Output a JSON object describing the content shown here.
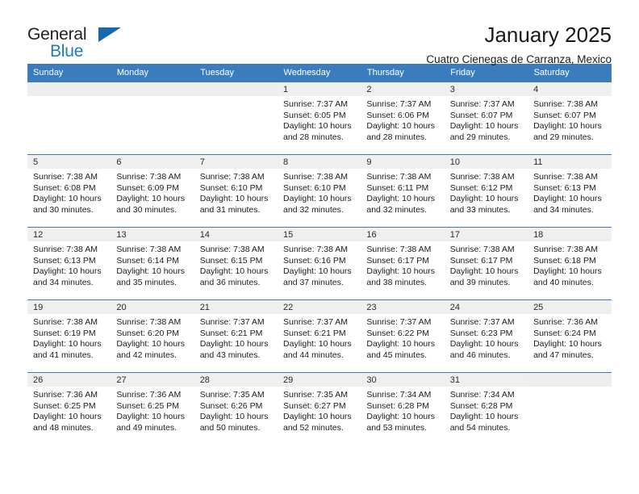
{
  "logo": {
    "word_top": "General",
    "word_bottom": "Blue",
    "triangle_color": "#1668ad",
    "text_color": "#231f20",
    "blue_color": "#1f7ac0"
  },
  "header": {
    "title": "January 2025",
    "subtitle": "Cuatro Cienegas de Carranza, Mexico"
  },
  "theme": {
    "header_bg": "#3b7cbf",
    "header_text": "#ffffff",
    "daynum_bg": "#efefef",
    "border": "#3b7cbf"
  },
  "weekdays": [
    "Sunday",
    "Monday",
    "Tuesday",
    "Wednesday",
    "Thursday",
    "Friday",
    "Saturday"
  ],
  "weeks": [
    [
      {
        "empty": true
      },
      {
        "empty": true
      },
      {
        "empty": true
      },
      {
        "day": "1",
        "sunrise": "Sunrise: 7:37 AM",
        "sunset": "Sunset: 6:05 PM",
        "daylight1": "Daylight: 10 hours",
        "daylight2": "and 28 minutes."
      },
      {
        "day": "2",
        "sunrise": "Sunrise: 7:37 AM",
        "sunset": "Sunset: 6:06 PM",
        "daylight1": "Daylight: 10 hours",
        "daylight2": "and 28 minutes."
      },
      {
        "day": "3",
        "sunrise": "Sunrise: 7:37 AM",
        "sunset": "Sunset: 6:07 PM",
        "daylight1": "Daylight: 10 hours",
        "daylight2": "and 29 minutes."
      },
      {
        "day": "4",
        "sunrise": "Sunrise: 7:38 AM",
        "sunset": "Sunset: 6:07 PM",
        "daylight1": "Daylight: 10 hours",
        "daylight2": "and 29 minutes."
      }
    ],
    [
      {
        "day": "5",
        "sunrise": "Sunrise: 7:38 AM",
        "sunset": "Sunset: 6:08 PM",
        "daylight1": "Daylight: 10 hours",
        "daylight2": "and 30 minutes."
      },
      {
        "day": "6",
        "sunrise": "Sunrise: 7:38 AM",
        "sunset": "Sunset: 6:09 PM",
        "daylight1": "Daylight: 10 hours",
        "daylight2": "and 30 minutes."
      },
      {
        "day": "7",
        "sunrise": "Sunrise: 7:38 AM",
        "sunset": "Sunset: 6:10 PM",
        "daylight1": "Daylight: 10 hours",
        "daylight2": "and 31 minutes."
      },
      {
        "day": "8",
        "sunrise": "Sunrise: 7:38 AM",
        "sunset": "Sunset: 6:10 PM",
        "daylight1": "Daylight: 10 hours",
        "daylight2": "and 32 minutes."
      },
      {
        "day": "9",
        "sunrise": "Sunrise: 7:38 AM",
        "sunset": "Sunset: 6:11 PM",
        "daylight1": "Daylight: 10 hours",
        "daylight2": "and 32 minutes."
      },
      {
        "day": "10",
        "sunrise": "Sunrise: 7:38 AM",
        "sunset": "Sunset: 6:12 PM",
        "daylight1": "Daylight: 10 hours",
        "daylight2": "and 33 minutes."
      },
      {
        "day": "11",
        "sunrise": "Sunrise: 7:38 AM",
        "sunset": "Sunset: 6:13 PM",
        "daylight1": "Daylight: 10 hours",
        "daylight2": "and 34 minutes."
      }
    ],
    [
      {
        "day": "12",
        "sunrise": "Sunrise: 7:38 AM",
        "sunset": "Sunset: 6:13 PM",
        "daylight1": "Daylight: 10 hours",
        "daylight2": "and 34 minutes."
      },
      {
        "day": "13",
        "sunrise": "Sunrise: 7:38 AM",
        "sunset": "Sunset: 6:14 PM",
        "daylight1": "Daylight: 10 hours",
        "daylight2": "and 35 minutes."
      },
      {
        "day": "14",
        "sunrise": "Sunrise: 7:38 AM",
        "sunset": "Sunset: 6:15 PM",
        "daylight1": "Daylight: 10 hours",
        "daylight2": "and 36 minutes."
      },
      {
        "day": "15",
        "sunrise": "Sunrise: 7:38 AM",
        "sunset": "Sunset: 6:16 PM",
        "daylight1": "Daylight: 10 hours",
        "daylight2": "and 37 minutes."
      },
      {
        "day": "16",
        "sunrise": "Sunrise: 7:38 AM",
        "sunset": "Sunset: 6:17 PM",
        "daylight1": "Daylight: 10 hours",
        "daylight2": "and 38 minutes."
      },
      {
        "day": "17",
        "sunrise": "Sunrise: 7:38 AM",
        "sunset": "Sunset: 6:17 PM",
        "daylight1": "Daylight: 10 hours",
        "daylight2": "and 39 minutes."
      },
      {
        "day": "18",
        "sunrise": "Sunrise: 7:38 AM",
        "sunset": "Sunset: 6:18 PM",
        "daylight1": "Daylight: 10 hours",
        "daylight2": "and 40 minutes."
      }
    ],
    [
      {
        "day": "19",
        "sunrise": "Sunrise: 7:38 AM",
        "sunset": "Sunset: 6:19 PM",
        "daylight1": "Daylight: 10 hours",
        "daylight2": "and 41 minutes."
      },
      {
        "day": "20",
        "sunrise": "Sunrise: 7:38 AM",
        "sunset": "Sunset: 6:20 PM",
        "daylight1": "Daylight: 10 hours",
        "daylight2": "and 42 minutes."
      },
      {
        "day": "21",
        "sunrise": "Sunrise: 7:37 AM",
        "sunset": "Sunset: 6:21 PM",
        "daylight1": "Daylight: 10 hours",
        "daylight2": "and 43 minutes."
      },
      {
        "day": "22",
        "sunrise": "Sunrise: 7:37 AM",
        "sunset": "Sunset: 6:21 PM",
        "daylight1": "Daylight: 10 hours",
        "daylight2": "and 44 minutes."
      },
      {
        "day": "23",
        "sunrise": "Sunrise: 7:37 AM",
        "sunset": "Sunset: 6:22 PM",
        "daylight1": "Daylight: 10 hours",
        "daylight2": "and 45 minutes."
      },
      {
        "day": "24",
        "sunrise": "Sunrise: 7:37 AM",
        "sunset": "Sunset: 6:23 PM",
        "daylight1": "Daylight: 10 hours",
        "daylight2": "and 46 minutes."
      },
      {
        "day": "25",
        "sunrise": "Sunrise: 7:36 AM",
        "sunset": "Sunset: 6:24 PM",
        "daylight1": "Daylight: 10 hours",
        "daylight2": "and 47 minutes."
      }
    ],
    [
      {
        "day": "26",
        "sunrise": "Sunrise: 7:36 AM",
        "sunset": "Sunset: 6:25 PM",
        "daylight1": "Daylight: 10 hours",
        "daylight2": "and 48 minutes."
      },
      {
        "day": "27",
        "sunrise": "Sunrise: 7:36 AM",
        "sunset": "Sunset: 6:25 PM",
        "daylight1": "Daylight: 10 hours",
        "daylight2": "and 49 minutes."
      },
      {
        "day": "28",
        "sunrise": "Sunrise: 7:35 AM",
        "sunset": "Sunset: 6:26 PM",
        "daylight1": "Daylight: 10 hours",
        "daylight2": "and 50 minutes."
      },
      {
        "day": "29",
        "sunrise": "Sunrise: 7:35 AM",
        "sunset": "Sunset: 6:27 PM",
        "daylight1": "Daylight: 10 hours",
        "daylight2": "and 52 minutes."
      },
      {
        "day": "30",
        "sunrise": "Sunrise: 7:34 AM",
        "sunset": "Sunset: 6:28 PM",
        "daylight1": "Daylight: 10 hours",
        "daylight2": "and 53 minutes."
      },
      {
        "day": "31",
        "sunrise": "Sunrise: 7:34 AM",
        "sunset": "Sunset: 6:28 PM",
        "daylight1": "Daylight: 10 hours",
        "daylight2": "and 54 minutes."
      },
      {
        "empty": true
      }
    ]
  ]
}
